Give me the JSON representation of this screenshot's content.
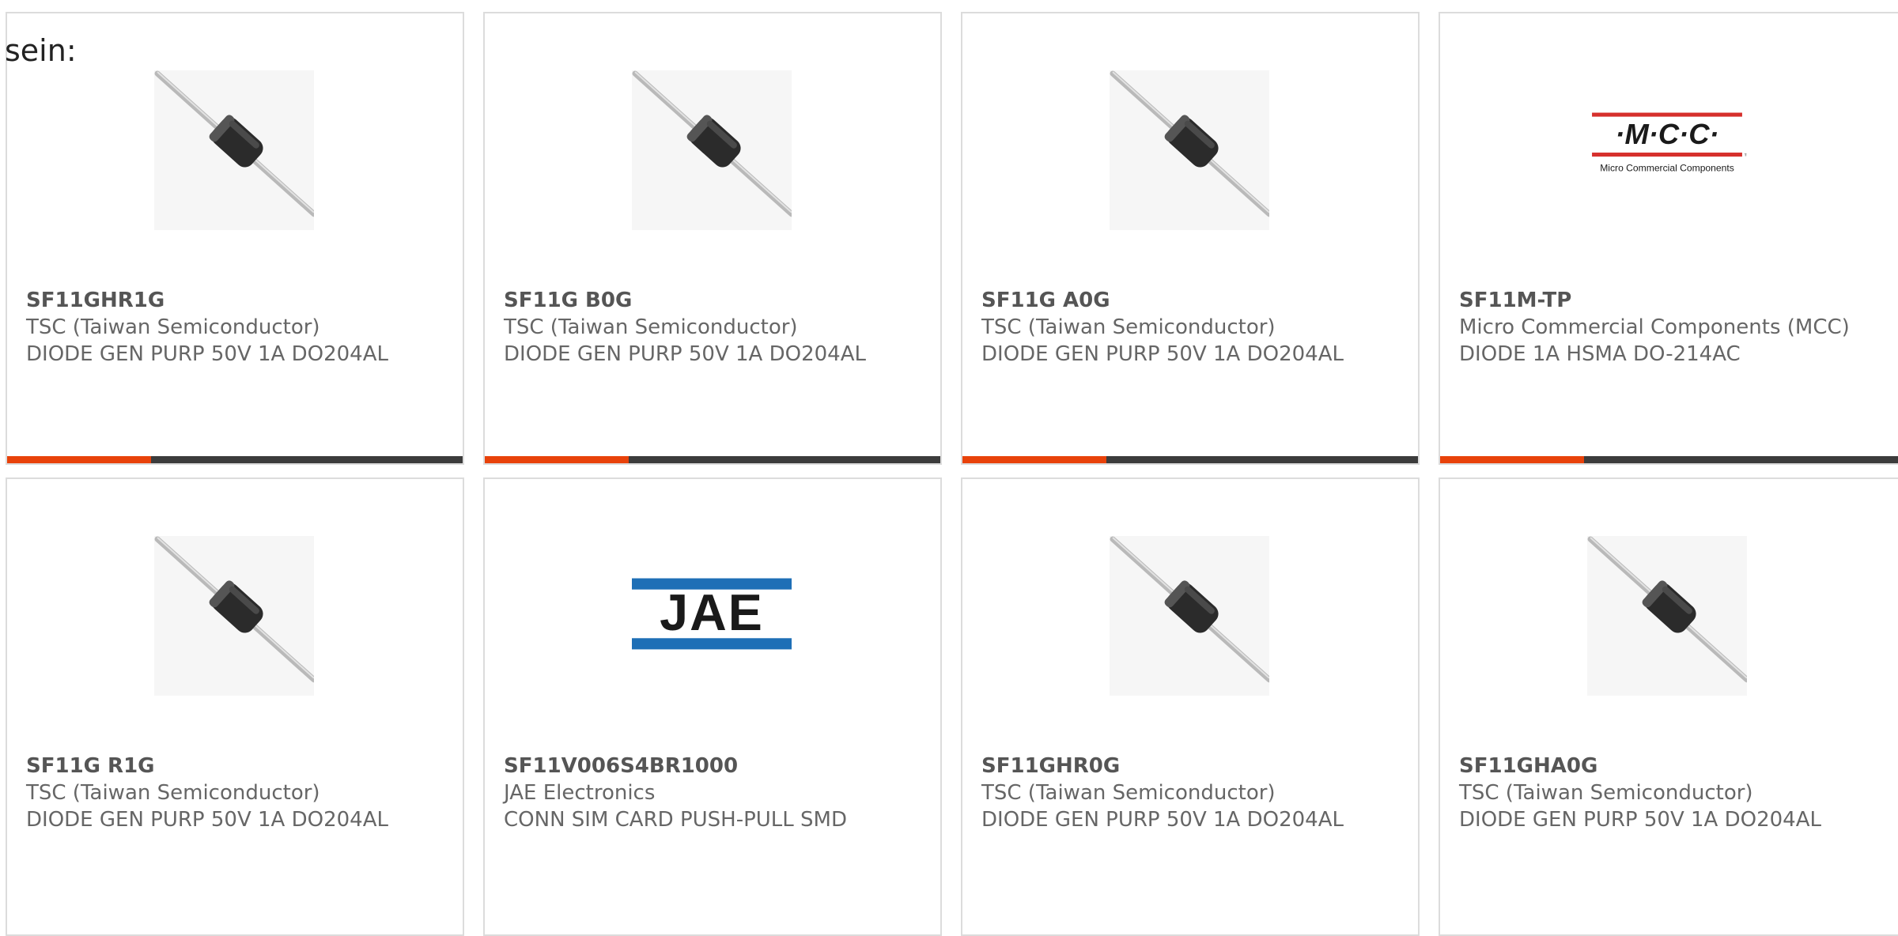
{
  "intro_text": "sein:",
  "colors": {
    "accent": "#e8420a",
    "bar_dark": "#3c3c3c",
    "card_border": "#dcdcdc",
    "jae_blue": "#1e6fb6",
    "mcc_red": "#d6302c"
  },
  "products": [
    {
      "part_number": "SF11GHR1G",
      "manufacturer": "TSC (Taiwan Semiconductor)",
      "description": "DIODE GEN PURP 50V 1A DO204AL",
      "image": "diode-image"
    },
    {
      "part_number": "SF11G B0G",
      "manufacturer": "TSC (Taiwan Semiconductor)",
      "description": "DIODE GEN PURP 50V 1A DO204AL",
      "image": "diode-image"
    },
    {
      "part_number": "SF11G A0G",
      "manufacturer": "TSC (Taiwan Semiconductor)",
      "description": "DIODE GEN PURP 50V 1A DO204AL",
      "image": "diode-image"
    },
    {
      "part_number": "SF11M-TP",
      "manufacturer": "Micro Commercial Components (MCC)",
      "description": "DIODE 1A HSMA DO-214AC",
      "image": "mcc-logo",
      "logo": {
        "mark": "·M·C·C·",
        "tagline": "Micro Commercial Components",
        "tm": "™"
      }
    },
    {
      "part_number": "SF11G R1G",
      "manufacturer": "TSC (Taiwan Semiconductor)",
      "description": "DIODE GEN PURP 50V 1A DO204AL",
      "image": "diode-image"
    },
    {
      "part_number": "SF11V006S4BR1000",
      "manufacturer": "JAE Electronics",
      "description": "CONN SIM CARD PUSH-PULL SMD",
      "image": "jae-logo",
      "logo": {
        "mark": "JAE"
      }
    },
    {
      "part_number": "SF11GHR0G",
      "manufacturer": "TSC (Taiwan Semiconductor)",
      "description": "DIODE GEN PURP 50V 1A DO204AL",
      "image": "diode-image"
    },
    {
      "part_number": "SF11GHA0G",
      "manufacturer": "TSC (Taiwan Semiconductor)",
      "description": "DIODE GEN PURP 50V 1A DO204AL",
      "image": "diode-image"
    }
  ]
}
